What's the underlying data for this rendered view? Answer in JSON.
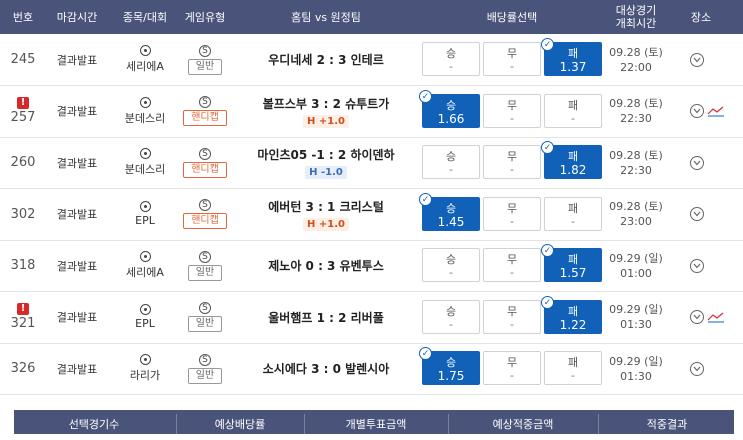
{
  "header": {
    "col_no": "번호",
    "col_deadline": "마감시간",
    "col_league": "종목/대회",
    "col_gametype": "게임유형",
    "col_match": "홈팀 vs 원정팀",
    "col_odds": "배당률선택",
    "col_datetime_line1": "대상경기",
    "col_datetime_line2": "개최시간",
    "col_place": "장소"
  },
  "rows": [
    {
      "no": "245",
      "alert": false,
      "deadline": "결과발표",
      "league": "세리에A",
      "type_icon": "S",
      "type": "일반",
      "handicap_type": false,
      "match": "우디네세 2 : 3 인테르",
      "handicap": "",
      "win_label": "승",
      "win_val": "-",
      "draw_label": "무",
      "draw_val": "-",
      "lose_label": "패",
      "lose_val": "1.37",
      "selected": "lose",
      "date": "09.28 (토)",
      "time": "22:00",
      "trend": false
    },
    {
      "no": "257",
      "alert": true,
      "deadline": "결과발표",
      "league": "분데스리",
      "type_icon": "S",
      "type": "핸디캡",
      "handicap_type": true,
      "match": "볼프스부 3 : 2 슈투트가",
      "handicap": "H +1.0",
      "win_label": "승",
      "win_val": "1.66",
      "draw_label": "무",
      "draw_val": "-",
      "lose_label": "패",
      "lose_val": "-",
      "selected": "win",
      "date": "09.28 (토)",
      "time": "22:30",
      "trend": true
    },
    {
      "no": "260",
      "alert": false,
      "deadline": "결과발표",
      "league": "분데스리",
      "type_icon": "S",
      "type": "핸디캡",
      "handicap_type": true,
      "match": "마인츠05 -1 : 2 하이덴하",
      "handicap": "H -1.0",
      "win_label": "승",
      "win_val": "-",
      "draw_label": "무",
      "draw_val": "-",
      "lose_label": "패",
      "lose_val": "1.82",
      "selected": "lose",
      "date": "09.28 (토)",
      "time": "22:30",
      "trend": false
    },
    {
      "no": "302",
      "alert": false,
      "deadline": "결과발표",
      "league": "EPL",
      "type_icon": "S",
      "type": "핸디캡",
      "handicap_type": true,
      "match": "에버턴 3 : 1 크리스털",
      "handicap": "H +1.0",
      "win_label": "승",
      "win_val": "1.45",
      "draw_label": "무",
      "draw_val": "-",
      "lose_label": "패",
      "lose_val": "-",
      "selected": "win",
      "date": "09.28 (토)",
      "time": "23:00",
      "trend": false
    },
    {
      "no": "318",
      "alert": false,
      "deadline": "결과발표",
      "league": "세리에A",
      "type_icon": "S",
      "type": "일반",
      "handicap_type": false,
      "match": "제노아 0 : 3 유벤투스",
      "handicap": "",
      "win_label": "승",
      "win_val": "-",
      "draw_label": "무",
      "draw_val": "-",
      "lose_label": "패",
      "lose_val": "1.57",
      "selected": "lose",
      "date": "09.29 (일)",
      "time": "01:00",
      "trend": false
    },
    {
      "no": "321",
      "alert": true,
      "deadline": "결과발표",
      "league": "EPL",
      "type_icon": "S",
      "type": "일반",
      "handicap_type": false,
      "match": "울버햄프 1 : 2 리버풀",
      "handicap": "",
      "win_label": "승",
      "win_val": "-",
      "draw_label": "무",
      "draw_val": "-",
      "lose_label": "패",
      "lose_val": "1.22",
      "selected": "lose",
      "date": "09.29 (일)",
      "time": "01:30",
      "trend": true
    },
    {
      "no": "326",
      "alert": false,
      "deadline": "결과발표",
      "league": "라리가",
      "type_icon": "S",
      "type": "일반",
      "handicap_type": false,
      "match": "소시에다 3 : 0 발렌시아",
      "handicap": "",
      "win_label": "승",
      "win_val": "1.75",
      "draw_label": "무",
      "draw_val": "-",
      "lose_label": "패",
      "lose_val": "-",
      "selected": "win",
      "date": "09.29 (일)",
      "time": "01:30",
      "trend": false
    }
  ],
  "footer": {
    "selected_count": "선택경기수",
    "expected_odds": "예상배당률",
    "individual_bet": "개별투표금액",
    "expected_payout": "예상적중금액",
    "result": "적중결과"
  },
  "colors": {
    "header_bg": "#4a5379",
    "selected_bg": "#1161b8",
    "handicap_plus": "#d0501d",
    "handicap_minus": "#3a6fb1",
    "alert": "#d62a2a"
  }
}
